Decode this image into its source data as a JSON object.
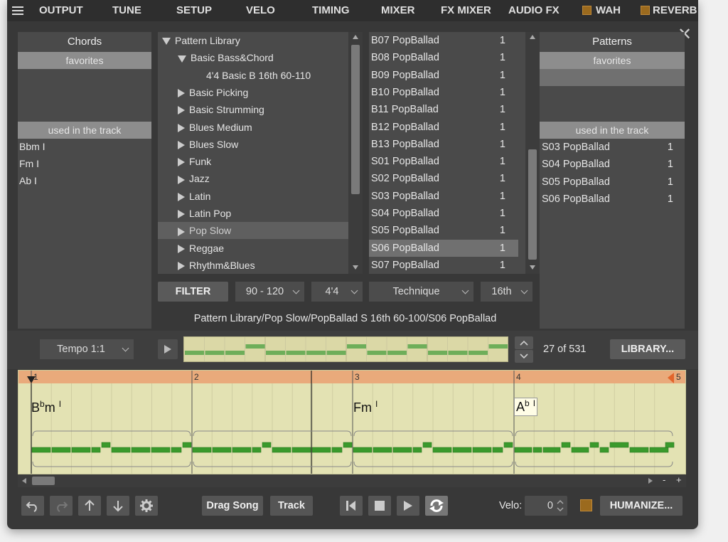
{
  "menu": {
    "tabs": [
      "OUTPUT",
      "TUNE",
      "SETUP",
      "VELO",
      "TIMING",
      "MIXER",
      "FX MIXER",
      "AUDIO FX"
    ],
    "checks": [
      "WAH",
      "REVERB"
    ]
  },
  "chords": {
    "title": "Chords",
    "favorites": "favorites",
    "used": "used in the track",
    "items": [
      "Bbm I",
      "Fm I",
      "Ab I"
    ]
  },
  "library": {
    "rows": [
      {
        "label": "Pattern Library",
        "expand": "open",
        "level": 0
      },
      {
        "label": "Basic Bass&Chord",
        "expand": "open",
        "level": 1
      },
      {
        "label": "4'4 Basic B 16th 60-110",
        "expand": "none",
        "level": 2
      },
      {
        "label": "Basic Picking",
        "expand": "closed",
        "level": 1
      },
      {
        "label": "Basic Strumming",
        "expand": "closed",
        "level": 1
      },
      {
        "label": "Blues Medium",
        "expand": "closed",
        "level": 1
      },
      {
        "label": "Blues Slow",
        "expand": "closed",
        "level": 1
      },
      {
        "label": "Funk",
        "expand": "closed",
        "level": 1
      },
      {
        "label": "Jazz",
        "expand": "closed",
        "level": 1
      },
      {
        "label": "Latin",
        "expand": "closed",
        "level": 1
      },
      {
        "label": "Latin Pop",
        "expand": "closed",
        "level": 1
      },
      {
        "label": "Pop Slow",
        "expand": "closed",
        "level": 1,
        "selected": true
      },
      {
        "label": "Reggae",
        "expand": "closed",
        "level": 1
      },
      {
        "label": "Rhythm&Blues",
        "expand": "closed",
        "level": 1
      }
    ]
  },
  "patternlist": {
    "rows": [
      {
        "name": "B07 PopBallad",
        "n": "1"
      },
      {
        "name": "B08 PopBallad",
        "n": "1"
      },
      {
        "name": "B09 PopBallad",
        "n": "1"
      },
      {
        "name": "B10 PopBallad",
        "n": "1"
      },
      {
        "name": "B11 PopBallad",
        "n": "1"
      },
      {
        "name": "B12 PopBallad",
        "n": "1"
      },
      {
        "name": "B13 PopBallad",
        "n": "1"
      },
      {
        "name": "S01 PopBallad",
        "n": "1"
      },
      {
        "name": "S02 PopBallad",
        "n": "1"
      },
      {
        "name": "S03 PopBallad",
        "n": "1"
      },
      {
        "name": "S04 PopBallad",
        "n": "1"
      },
      {
        "name": "S05 PopBallad",
        "n": "1"
      },
      {
        "name": "S06 PopBallad",
        "n": "1",
        "selected": true
      },
      {
        "name": "S07 PopBallad",
        "n": "1"
      }
    ]
  },
  "patterns": {
    "title": "Patterns",
    "favorites": "favorites",
    "used": "used in the track",
    "items": [
      {
        "name": "S03 PopBallad",
        "n": "1"
      },
      {
        "name": "S04 PopBallad",
        "n": "1"
      },
      {
        "name": "S05 PopBallad",
        "n": "1"
      },
      {
        "name": "S06 PopBallad",
        "n": "1"
      }
    ]
  },
  "filter": {
    "label": "FILTER",
    "tempo": "90 - 120",
    "meter": "4'4",
    "technique": "Technique",
    "division": "16th"
  },
  "path": "Pattern Library/Pop Slow/PopBallad S 16th 60-100/S06 PopBallad",
  "preview": {
    "tempo": "Tempo 1:1",
    "count": "27 of 531",
    "library_btn": "LIBRARY..."
  },
  "track": {
    "bars": [
      "1",
      "2",
      "3",
      "4",
      "5"
    ],
    "chord1": {
      "root": "B",
      "acc": "b",
      "qual": "m",
      "deg": "I"
    },
    "chord2": {
      "root": "F",
      "acc": "",
      "qual": "m",
      "deg": "I"
    },
    "chord3": {
      "root": "A",
      "acc": "b",
      "qual": "",
      "deg": "I"
    },
    "zoom_minus": "-",
    "zoom_plus": "+"
  },
  "bottom": {
    "drag_song": "Drag Song",
    "track": "Track",
    "velo_label": "Velo:",
    "velo_value": "0",
    "humanize": "HUMANIZE..."
  },
  "colors": {
    "accent_orange": "#e9aa7b",
    "track_bg": "#e3e2b3",
    "note_green": "#3a9a2c",
    "check_brown": "#9b6a1e"
  }
}
